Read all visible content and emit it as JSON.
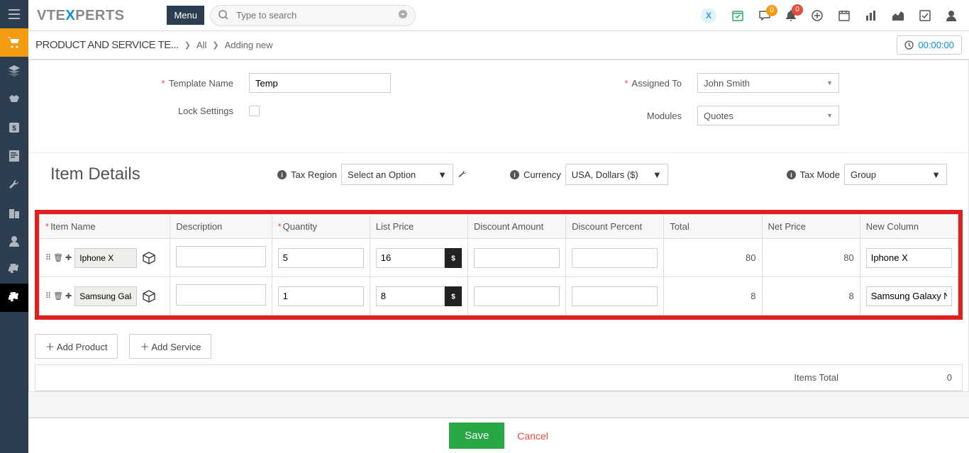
{
  "header": {
    "menu_label": "Menu",
    "search_placeholder": "Type to search",
    "badges": {
      "chat": "0",
      "bell": "0"
    }
  },
  "breadcrumb": {
    "title": "PRODUCT AND SERVICE TE...",
    "link1": "All",
    "link2": "Adding new",
    "timer": "00:00:00"
  },
  "form": {
    "template_name_label": "Template Name",
    "template_name_value": "Temp",
    "lock_label": "Lock Settings",
    "assigned_label": "Assigned To",
    "assigned_value": "John Smith",
    "modules_label": "Modules",
    "modules_value": "Quotes"
  },
  "item_details": {
    "section_title": "Item Details",
    "tax_region_label": "Tax Region",
    "tax_region_value": "Select an Option",
    "currency_label": "Currency",
    "currency_value": "USA, Dollars ($)",
    "tax_mode_label": "Tax Mode",
    "tax_mode_value": "Group",
    "columns": {
      "item": "Item Name",
      "desc": "Description",
      "qty": "Quantity",
      "list_price": "List Price",
      "disc_amt": "Discount Amount",
      "disc_pct": "Discount Percent",
      "total": "Total",
      "net": "Net Price",
      "new_col": "New Column"
    },
    "rows": [
      {
        "name": "Iphone X",
        "qty": "5",
        "price": "16",
        "total": "80",
        "net": "80",
        "new_col": "Iphone X"
      },
      {
        "name": "Samsung Gala",
        "qty": "1",
        "price": "8",
        "total": "8",
        "net": "8",
        "new_col": "Samsung Galaxy N"
      }
    ],
    "add_product": "Add Product",
    "add_service": "Add Service"
  },
  "totals": {
    "items_total_label": "Items Total",
    "items_total_value": "0"
  },
  "footer": {
    "save": "Save",
    "cancel": "Cancel"
  }
}
